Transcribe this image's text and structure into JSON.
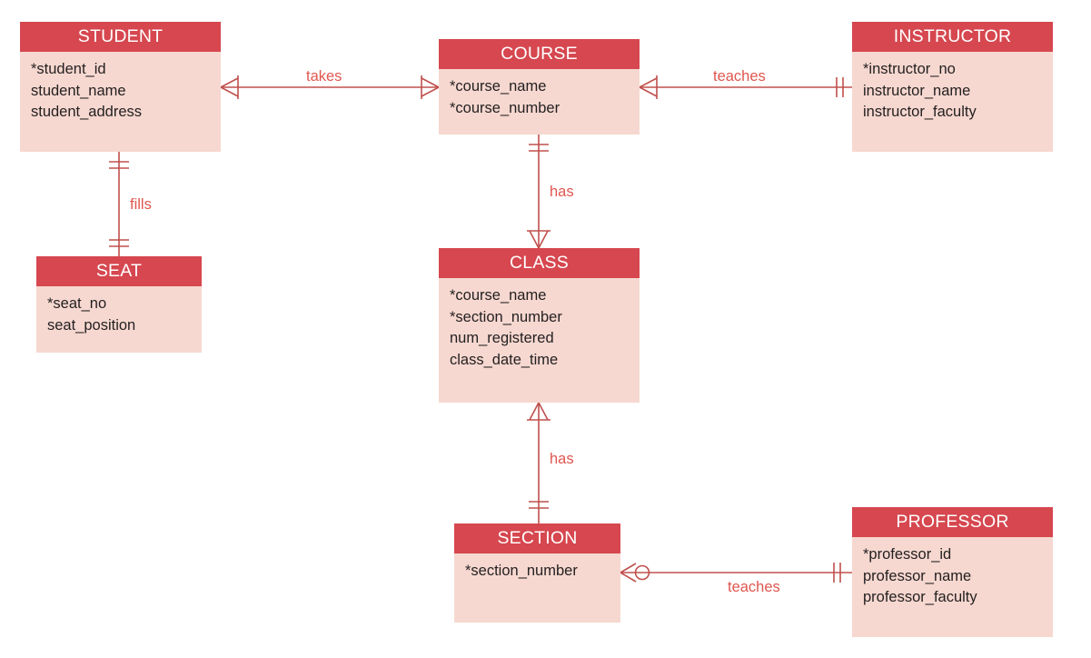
{
  "diagram": {
    "type": "entity-relationship-diagram",
    "notation": "crows-foot",
    "colors": {
      "entity_header_bg": "#D6474F",
      "entity_header_text": "#FFFFFF",
      "entity_body_bg": "#F6D8D0",
      "attribute_text": "#231F20",
      "connector_line": "#C0504D",
      "relationship_label_text": "#E0564F",
      "canvas_bg": "#FFFFFF"
    }
  },
  "entities": [
    {
      "id": "student",
      "name": "STUDENT",
      "attributes": [
        "*student_id",
        "student_name",
        "student_address"
      ]
    },
    {
      "id": "course",
      "name": "COURSE",
      "attributes": [
        "*course_name",
        "*course_number"
      ]
    },
    {
      "id": "instructor",
      "name": "INSTRUCTOR",
      "attributes": [
        "*instructor_no",
        "instructor_name",
        "instructor_faculty"
      ]
    },
    {
      "id": "seat",
      "name": "SEAT",
      "attributes": [
        "*seat_no",
        "seat_position"
      ]
    },
    {
      "id": "class",
      "name": "CLASS",
      "attributes": [
        "*course_name",
        "*section_number",
        "num_registered",
        "class_date_time"
      ]
    },
    {
      "id": "section",
      "name": "SECTION",
      "attributes": [
        "*section_number"
      ]
    },
    {
      "id": "professor",
      "name": "PROFESSOR",
      "attributes": [
        "*professor_id",
        "professor_name",
        "professor_faculty"
      ]
    }
  ],
  "relationships": [
    {
      "id": "student-takes-course",
      "label": "takes",
      "from": "STUDENT",
      "to": "COURSE",
      "from_cardinality": "many",
      "to_cardinality": "many"
    },
    {
      "id": "course-teaches-instructor",
      "label": "teaches",
      "from": "COURSE",
      "to": "INSTRUCTOR",
      "from_cardinality": "many",
      "to_cardinality": "one-and-only-one"
    },
    {
      "id": "student-fills-seat",
      "label": "fills",
      "from": "STUDENT",
      "to": "SEAT",
      "from_cardinality": "one-and-only-one",
      "to_cardinality": "one-and-only-one"
    },
    {
      "id": "course-has-class",
      "label": "has",
      "from": "COURSE",
      "to": "CLASS",
      "from_cardinality": "one-and-only-one",
      "to_cardinality": "many"
    },
    {
      "id": "class-has-section",
      "label": "has",
      "from": "CLASS",
      "to": "SECTION",
      "from_cardinality": "many",
      "to_cardinality": "one-and-only-one"
    },
    {
      "id": "section-teaches-professor",
      "label": "teaches",
      "from": "SECTION",
      "to": "PROFESSOR",
      "from_cardinality": "zero-or-many",
      "to_cardinality": "one-and-only-one"
    }
  ]
}
